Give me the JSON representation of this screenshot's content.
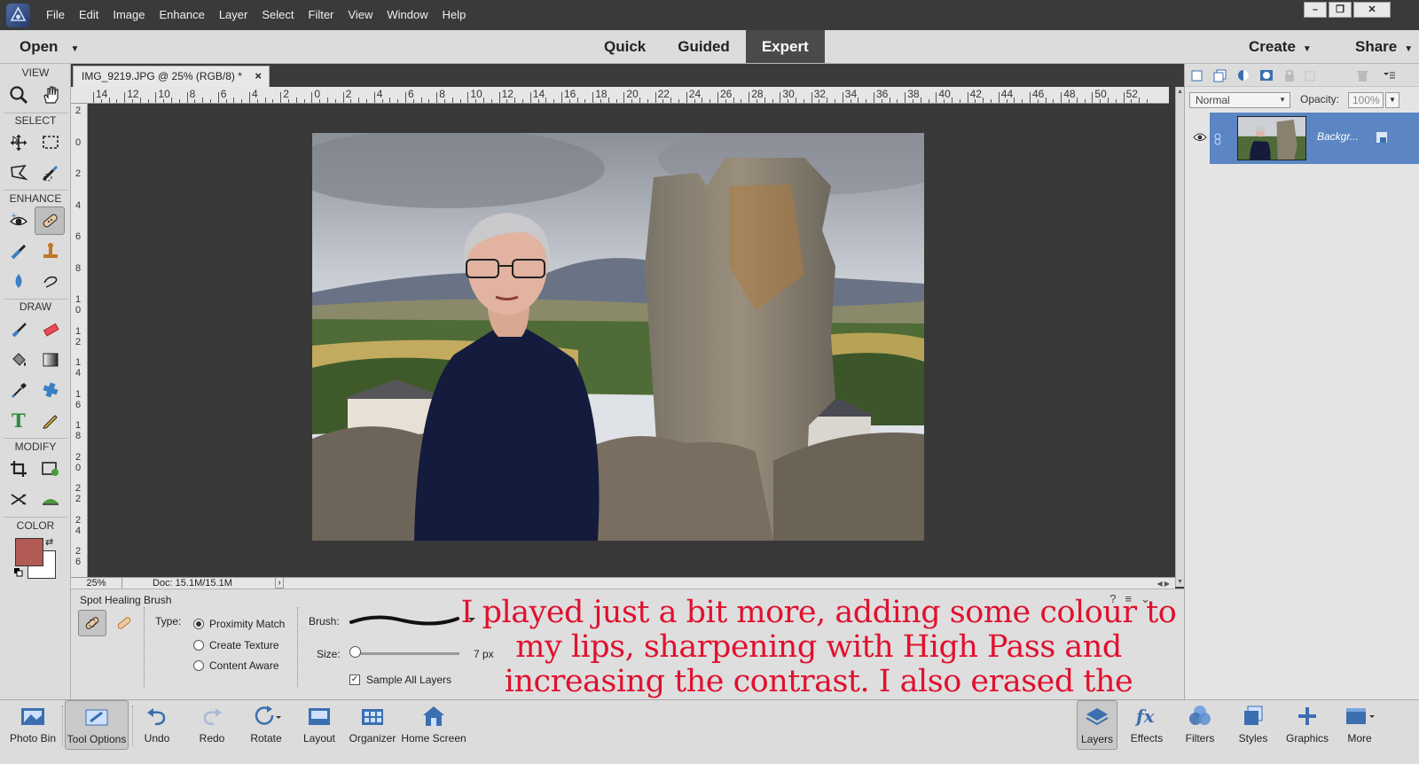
{
  "menubar": {
    "items": [
      "File",
      "Edit",
      "Image",
      "Enhance",
      "Layer",
      "Select",
      "Filter",
      "View",
      "Window",
      "Help"
    ]
  },
  "modebar": {
    "open_label": "Open",
    "tabs": [
      {
        "label": "Quick",
        "active": false
      },
      {
        "label": "Guided",
        "active": false
      },
      {
        "label": "Expert",
        "active": true
      }
    ],
    "create_label": "Create",
    "share_label": "Share"
  },
  "toolbox": {
    "sections": [
      "VIEW",
      "SELECT",
      "ENHANCE",
      "DRAW",
      "MODIFY",
      "COLOR"
    ],
    "icons": [
      "zoom-icon",
      "hand-icon",
      "move-icon",
      "marquee-icon",
      "lasso-icon",
      "quick-selection-icon",
      "red-eye-icon",
      "spot-healing-brush-icon",
      "smart-brush-icon",
      "clone-stamp-icon",
      "blur-icon",
      "smudge-icon",
      "brush-icon",
      "eraser-icon",
      "paint-bucket-icon",
      "gradient-icon",
      "eyedropper-icon",
      "custom-shape-icon",
      "type-icon",
      "pencil-icon",
      "crop-icon",
      "recompose-icon",
      "content-aware-move-icon",
      "straighten-icon"
    ],
    "foreground_color": "#b25b55",
    "background_color": "#ffffff"
  },
  "document": {
    "tab_title": "IMG_9219.JPG @ 25% (RGB/8) *",
    "ruler_top": [
      "14",
      "12",
      "10",
      "8",
      "6",
      "4",
      "2",
      "0",
      "2",
      "4",
      "6",
      "8",
      "10",
      "12",
      "14",
      "16",
      "18",
      "20",
      "22",
      "24",
      "26",
      "28",
      "30",
      "32",
      "34",
      "36",
      "38",
      "40",
      "42",
      "44",
      "46",
      "48",
      "50",
      "52"
    ],
    "ruler_left": [
      "2",
      "0",
      "2",
      "4",
      "6",
      "8",
      "1\n0",
      "1\n2",
      "1\n4",
      "1\n6",
      "1\n8",
      "2\n0",
      "2\n2",
      "2\n4",
      "2\n6"
    ],
    "zoom": "25%",
    "doc_size": "Doc: 15.1M/15.1M"
  },
  "tool_options": {
    "tool_name": "Spot Healing Brush",
    "type_label": "Type:",
    "type_options": [
      {
        "label": "Proximity Match",
        "selected": true
      },
      {
        "label": "Create Texture",
        "selected": false
      },
      {
        "label": "Content Aware",
        "selected": false
      }
    ],
    "brush_label": "Brush:",
    "size_label": "Size:",
    "size_value": "7 px",
    "size_fraction": 0.02,
    "sample_all_layers_label": "Sample All Layers",
    "sample_all_layers_checked": true
  },
  "annotation": {
    "text": "I played just a bit more, adding some colour to my lips, sharpening with High Pass and increasing the contrast. I also erased the creases on my neck and my surgical scar too.",
    "color": "#e0112e"
  },
  "layers_panel": {
    "blend_mode": "Normal",
    "opacity_label": "Opacity:",
    "opacity_value": "100%",
    "layer_name": "Backgr...",
    "selected_color": "#5b86c3"
  },
  "taskbar": {
    "left": [
      {
        "label": "Photo Bin",
        "icon": "photo-bin-icon"
      },
      {
        "label": "Tool Options",
        "icon": "tool-options-icon"
      },
      {
        "label": "Undo",
        "icon": "undo-icon"
      },
      {
        "label": "Redo",
        "icon": "redo-icon"
      },
      {
        "label": "Rotate",
        "icon": "rotate-icon"
      },
      {
        "label": "Layout",
        "icon": "layout-icon"
      },
      {
        "label": "Organizer",
        "icon": "organizer-icon"
      },
      {
        "label": "Home Screen",
        "icon": "home-screen-icon"
      }
    ],
    "right": [
      {
        "label": "Layers",
        "icon": "layers-icon"
      },
      {
        "label": "Effects",
        "icon": "effects-icon"
      },
      {
        "label": "Filters",
        "icon": "filters-icon"
      },
      {
        "label": "Styles",
        "icon": "styles-icon"
      },
      {
        "label": "Graphics",
        "icon": "graphics-icon"
      },
      {
        "label": "More",
        "icon": "more-icon"
      }
    ]
  }
}
